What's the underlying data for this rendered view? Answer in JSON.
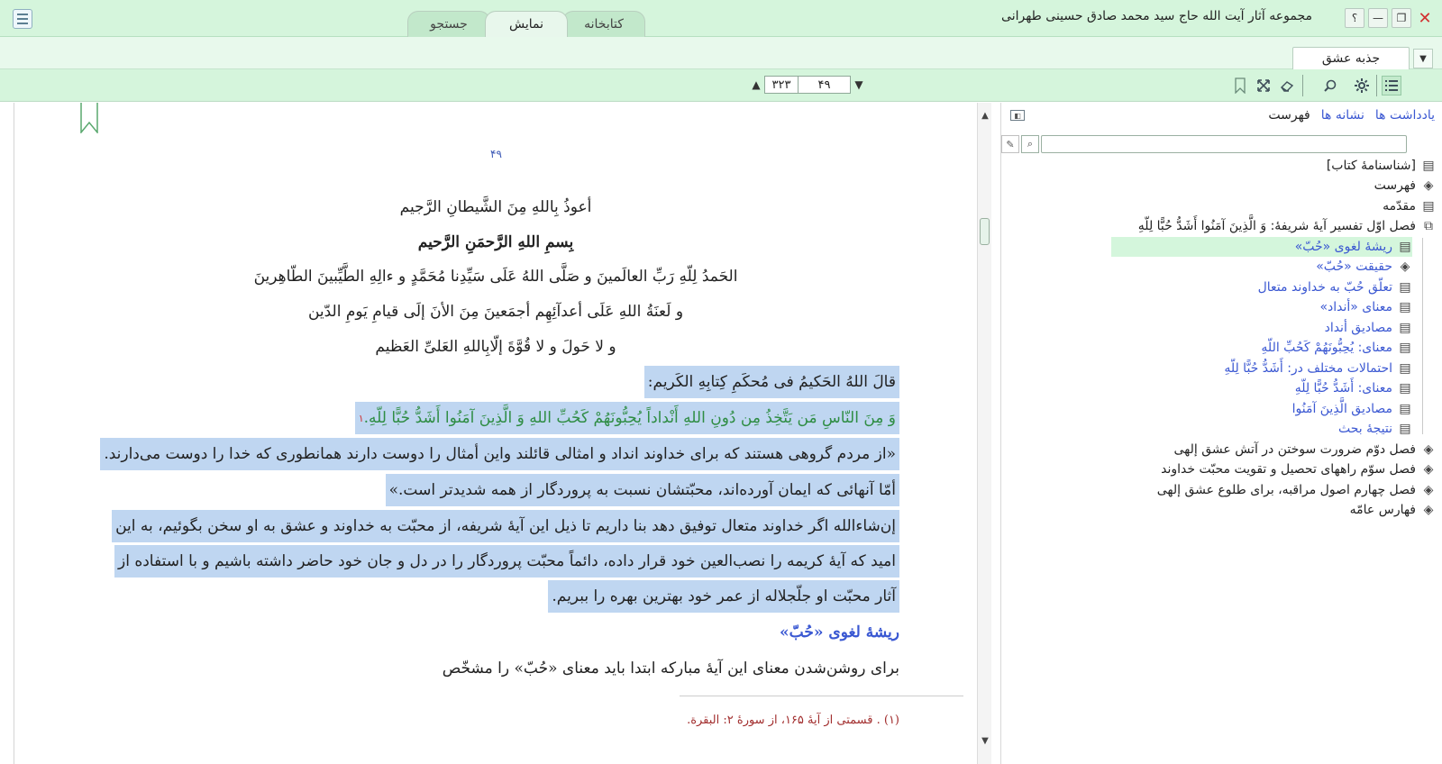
{
  "app": {
    "title": "مجموعه آثار آیت الله حاج سید محمد صادق حسینی طهرانی",
    "window_buttons": [
      "؟",
      "—",
      "❐",
      "✕"
    ]
  },
  "tabs": [
    {
      "label": "کتابخانه",
      "active": false
    },
    {
      "label": "نمایش",
      "active": true
    },
    {
      "label": "جستجو",
      "active": false
    }
  ],
  "doc_tab": {
    "label": "جذبه عشق"
  },
  "navigation": {
    "current_page": "۴۹",
    "total_pages": "۳۲۳"
  },
  "reader": {
    "page_number": "۴۹",
    "lines": [
      "أعوذُ بِاللهِ مِنَ الشَّیطانِ الرَّجیم",
      "بِسمِ اللهِ الرَّحمَنِ الرَّحیم",
      "الحَمدُ لِلّهِ رَبِّ العالَمینَ و صَلَّی اللهُ عَلَی سَیِّدِنا مُحَمَّدٍ و ءالِهِ الطَّیِّبینَ الطّاهِرینَ",
      "و لَعنَةُ اللهِ عَلَی أعدآئِهِم أجمَعینَ مِنَ الأنَ إلَی قیامِ یَومِ الدّین",
      "و لا حَولَ و لا قُوَّةَ إلّابِاللهِ العَلیِّ العَظیم",
      "قالَ اللهُ الحَکیمُ فی مُحکَمِ کِتابِهِ الکَریم:",
      "وَ مِنَ النّاسِ مَن یَتَّخِذُ مِن دُونِ اللهِ أَنْداداً یُحِبُّونَهُمْ کَحُبِّ اللهِ وَ الَّذِینَ آمَنُوا أَشَدُّ حُبًّا لِلّهِ.",
      "«از مردم گروهی هستند که برای خداوند انداد و امثالی قائلند واین أمثال را دوست دارند همانطوری که خدا را دوست می‌دارند.",
      "أمّا آنهائی که ایمان آورده‌اند، محبّتشان نسبت به پروردگار از همه شدیدتر است.»",
      "إن‌شاءالله اگر خداوند متعال توفیق دهد بنا داریم تا ذیل این آیهٔ شریفه، از محبّت به خداوند و عشق به او سخن بگوئیم، به این",
      "امید که آیهٔ کریمه را نصب‌العین خود قرار داده، دائماً محبّت پروردگار را در دل و جان خود حاضر داشته باشیم و با استفاده از",
      "آثار محبّت او جلّجلاله از عمر خود بهترین بهره را ببریم.",
      "ریشهٔ لغوی «حُبّ»",
      "برای روشن‌شدن معنای این آیهٔ مبارکه ابتدا باید معنای «حُبّ» را مشخّص"
    ],
    "footnote_marker": "۱",
    "footnote": "(۱) . قسمتی از آیهٔ ۱۶۵، از سورهٔ ۲: البقرة."
  },
  "side_panel": {
    "tabs": [
      "فهرست",
      "نشانه ها",
      "یادداشت ها"
    ],
    "search_placeholder": "",
    "toc": [
      {
        "label": "[شناسنامهٔ کتاب]",
        "icon": "page-icon",
        "level": 0
      },
      {
        "label": "فهرست",
        "icon": "book-icon",
        "level": 0
      },
      {
        "label": "مقدّمه",
        "icon": "page-icon",
        "level": 0
      },
      {
        "label": "فصل اوّل تفسیر آیهٔ شریفهٔ: وَ الَّذِینَ آمَنُوا أَشَدُّ حُبًّا لِلّهِ",
        "icon": "open-book-icon",
        "level": 0
      },
      {
        "label": "ریشهٔ لغوی «حُبّ»",
        "icon": "page-icon",
        "level": 1,
        "selected": true
      },
      {
        "label": "حقیقت «حُبّ»",
        "icon": "book-icon",
        "level": 1
      },
      {
        "label": "تعلّق حُبّ به خداوند متعال",
        "icon": "page-icon",
        "level": 1
      },
      {
        "label": "معنای «أنداد»",
        "icon": "page-icon",
        "level": 1
      },
      {
        "label": "مصادیق أنداد",
        "icon": "page-icon",
        "level": 1
      },
      {
        "label": "معنای: یُحِبُّونَهُمْ کَحُبِّ اللّهِ",
        "icon": "page-icon",
        "level": 1
      },
      {
        "label": "احتمالات مختلف در: أَشَدُّ حُبًّا لِلّهِ",
        "icon": "page-icon",
        "level": 1
      },
      {
        "label": "معنای: أَشَدُّ حُبًّا لِلّهِ",
        "icon": "page-icon",
        "level": 1
      },
      {
        "label": "مصادیق الَّذِینَ آمَنُوا",
        "icon": "page-icon",
        "level": 1
      },
      {
        "label": "نتیجهٔ بحث",
        "icon": "page-icon",
        "level": 1
      },
      {
        "label": "فصل دوّم ضرورت سوختن در آتش عشق إلهی",
        "icon": "book-icon",
        "level": 0
      },
      {
        "label": "فصل سوّم راههای تحصیل و تقویت محبّت خداوند",
        "icon": "book-icon",
        "level": 0
      },
      {
        "label": "فصل چهارم اصول مراقبه، برای طلوع عشق إلهی",
        "icon": "book-icon",
        "level": 0
      },
      {
        "label": "فهارس عامّه",
        "icon": "book-icon",
        "level": 0
      }
    ]
  },
  "colors": {
    "chrome_green": "#d5f5dc",
    "selection_blue": "#bfd6f1",
    "quran_green": "#2f8d44",
    "heading_blue": "#3a58d2",
    "footnote_red": "#a22e2e"
  }
}
